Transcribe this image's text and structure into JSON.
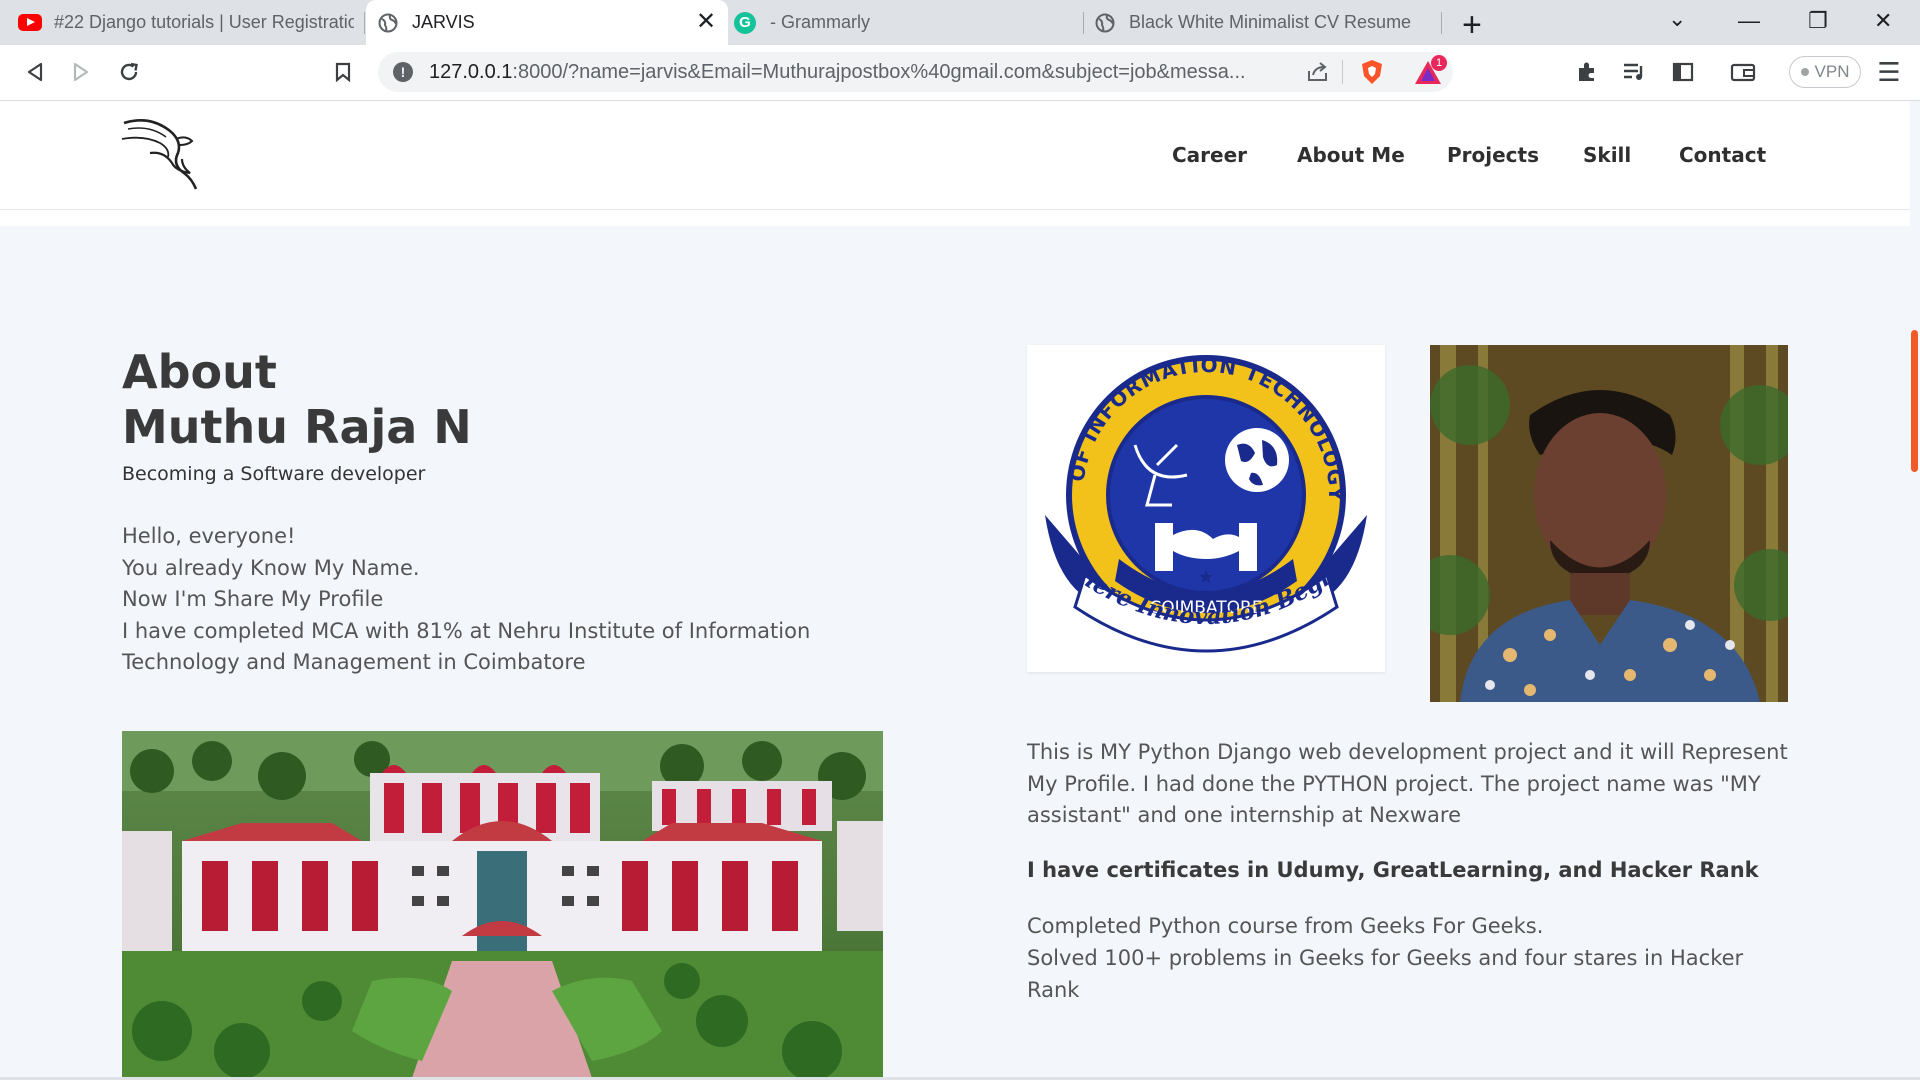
{
  "browser": {
    "tabs": [
      {
        "title": "#22 Django tutorials | User Registratio",
        "icon": "youtube-icon"
      },
      {
        "title": "JARVIS",
        "icon": "globe-icon",
        "active": true
      },
      {
        "title": "- Grammarly",
        "icon": "grammarly-icon"
      },
      {
        "title": "Black White Minimalist CV Resume",
        "icon": "globe-icon"
      }
    ],
    "new_tab": "+",
    "address": {
      "host": "127.0.0.1",
      "rest": ":8000/?name=jarvis&Email=Muthurajpostbox%40gmail.com&subject=job&messa..."
    },
    "brave_badge": "1",
    "vpn_label": "VPN"
  },
  "nav": {
    "items": [
      "Career",
      "About Me",
      "Projects",
      "Skill",
      "Contact"
    ]
  },
  "about": {
    "title_line1": "About",
    "title_line2": "Muthu Raja N",
    "subtitle": "Becoming a Software developer",
    "intro": [
      "Hello, everyone!",
      "You already Know My Name.",
      "Now I'm Share My Profile",
      "I have completed MCA with 81% at Nehru Institute of Information",
      "Technology and Management in Coimbatore"
    ]
  },
  "college_logo": {
    "ring_text": "NEHRU INSTITUTE OF INFORMATION TECHNOLOGY & MANAGEMENT",
    "city": "COIMBATORE",
    "motto": "Where Innovation Begins"
  },
  "details": {
    "project": "This is MY Python Django web development project and it will Represent My Profile. I had done the PYTHON project. The project name was \"MY assistant\" and one internship at Nexware",
    "certificates": "I have certificates in Udumy, GreatLearning, and Hacker Rank",
    "course": "Completed Python course from Geeks For Geeks.",
    "problems": "Solved 100+ problems in Geeks for Geeks and four stares in Hacker Rank"
  },
  "colors": {
    "accent_scrollbar": "#f05a28",
    "page_bg": "#f3f6fb",
    "logo_blue": "#1a2a8c",
    "logo_yellow": "#f2c21b"
  }
}
